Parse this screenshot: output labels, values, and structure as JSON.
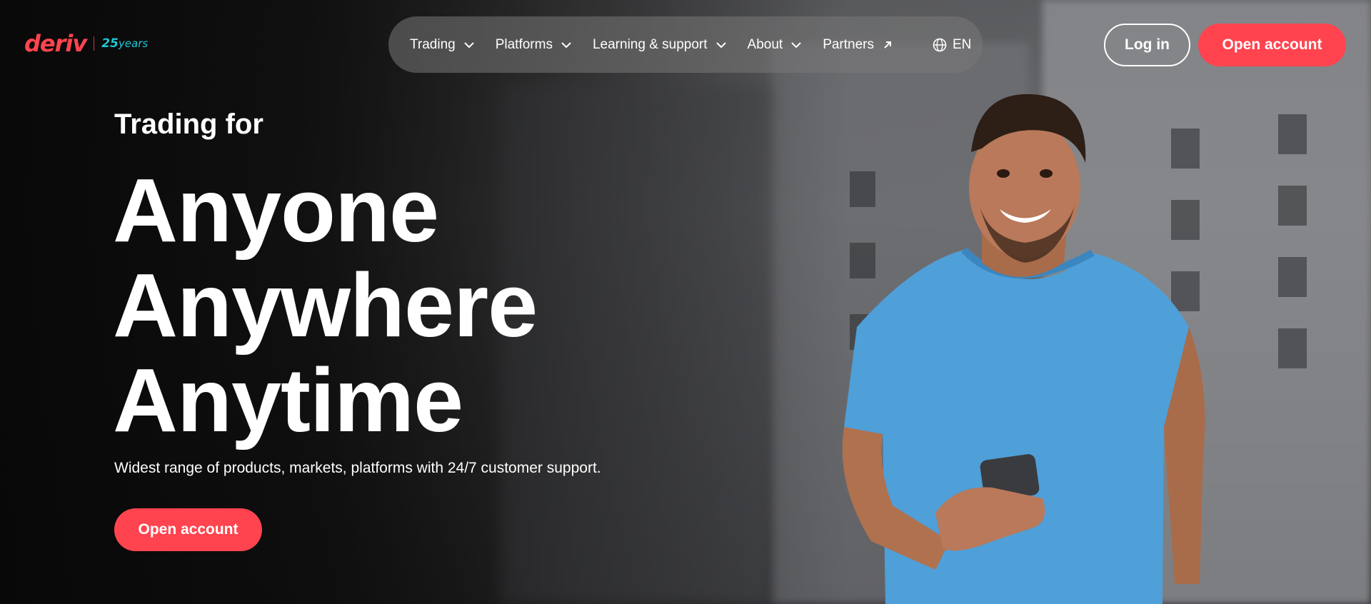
{
  "brand": {
    "name": "deriv",
    "badge_number": "25",
    "badge_text": "years",
    "accent": "#ff444f",
    "badge_color": "#1ec8d4"
  },
  "nav": {
    "items": [
      {
        "label": "Trading",
        "icon": "chevron-down-icon"
      },
      {
        "label": "Platforms",
        "icon": "chevron-down-icon"
      },
      {
        "label": "Learning & support",
        "icon": "chevron-down-icon"
      },
      {
        "label": "About",
        "icon": "chevron-down-icon"
      },
      {
        "label": "Partners",
        "icon": "arrow-up-right-icon"
      }
    ],
    "language": {
      "label": "EN",
      "icon": "globe-icon"
    }
  },
  "header_actions": {
    "login_label": "Log in",
    "open_account_label": "Open account"
  },
  "hero": {
    "eyebrow": "Trading for",
    "headline": [
      "Anyone",
      "Anywhere",
      "Anytime"
    ],
    "subtext": "Widest range of products, markets, platforms with 24/7 customer support.",
    "cta_label": "Open account"
  }
}
